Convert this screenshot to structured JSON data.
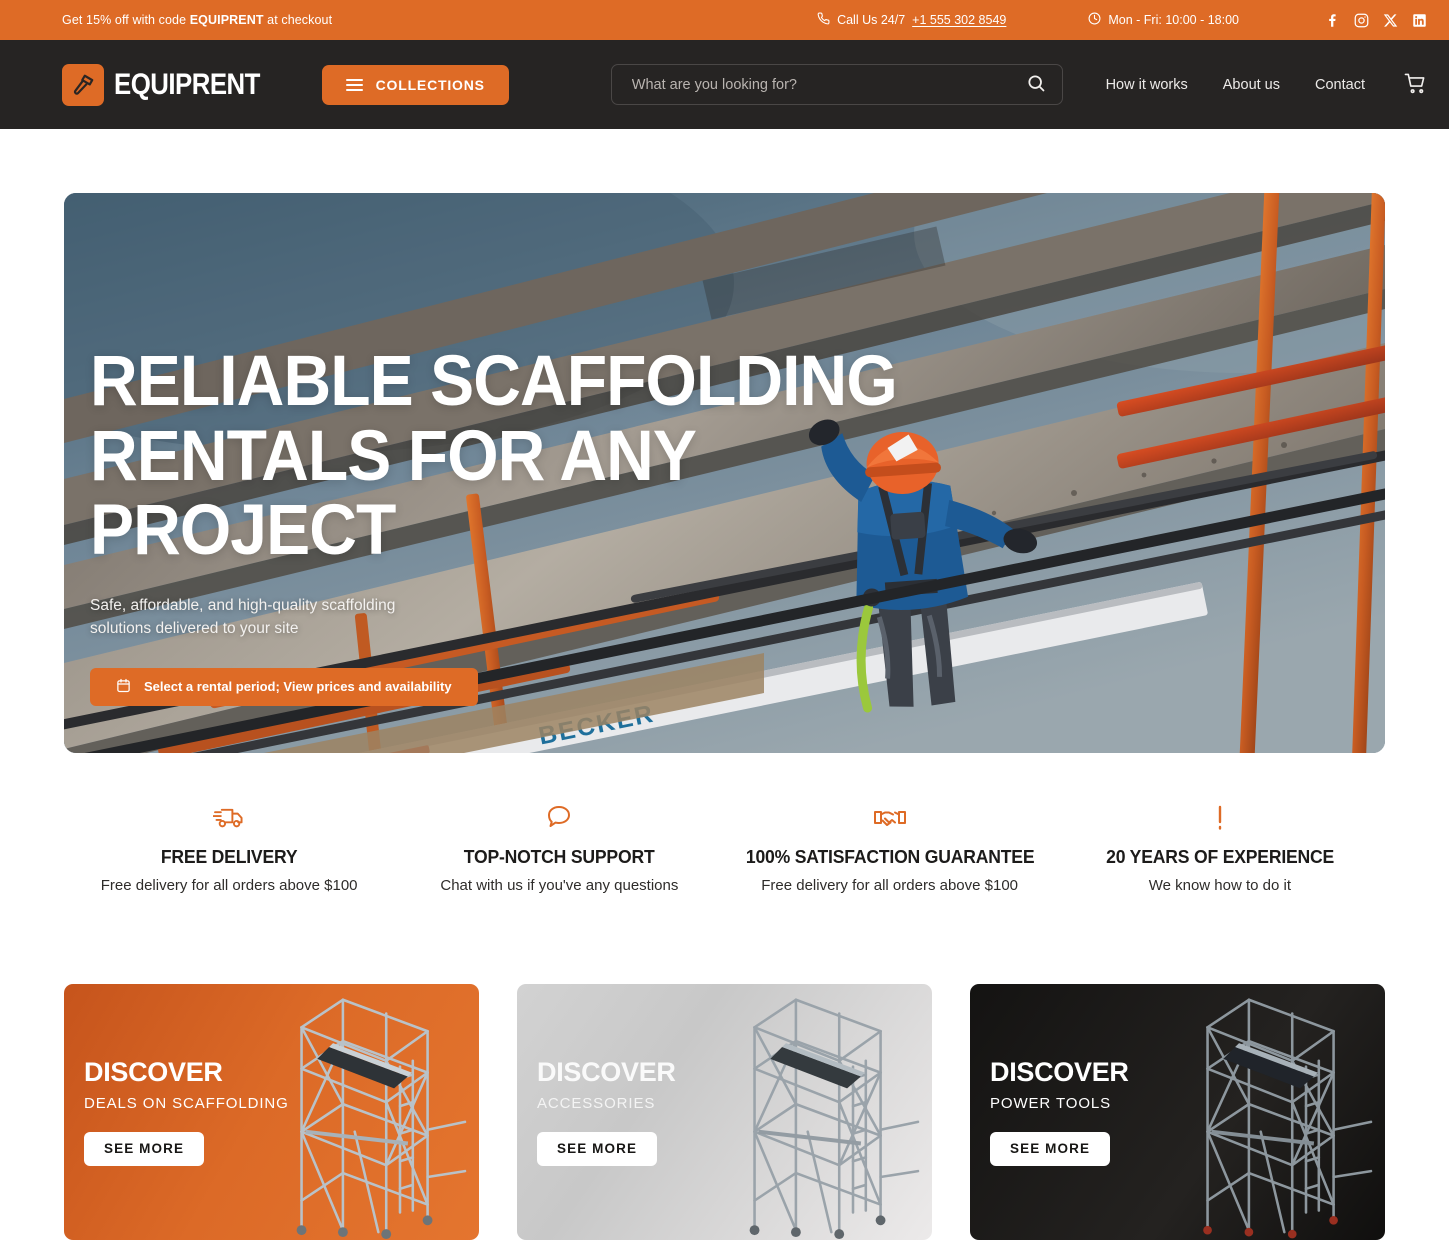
{
  "announcement": {
    "promo_prefix": "Get 15% off with code ",
    "promo_code": "EQUIPRENT",
    "promo_suffix": " at checkout",
    "phone_label": "Call Us 24/7",
    "phone_number": "+1 555 302 8549",
    "hours": "Mon - Fri: 10:00 - 18:00",
    "socials": [
      "facebook-icon",
      "instagram-icon",
      "x-twitter-icon",
      "linkedin-icon"
    ],
    "background_color": "#DE6B26"
  },
  "header": {
    "brand_name": "EQUIPRENT",
    "brand_icon": "hammer-icon",
    "collections_label": "COLLECTIONS",
    "search_placeholder": "What are you looking for?",
    "search_value": "",
    "nav": [
      {
        "label": "How it works"
      },
      {
        "label": "About us"
      },
      {
        "label": "Contact"
      }
    ],
    "cart_icon": "shopping-cart-icon",
    "background_color": "#262423"
  },
  "hero": {
    "title_line1": "RELIABLE SCAFFOLDING",
    "title_line2": "RENTALS FOR ANY PROJECT",
    "subtitle": "Safe, affordable, and high-quality scaffolding solutions delivered to your site",
    "cta_label": "Select a rental period; View prices and availability",
    "cta_icon": "calendar-icon",
    "accent_color": "#DE6B26"
  },
  "features": [
    {
      "icon": "delivery-truck-icon",
      "title": "FREE DELIVERY",
      "desc": "Free delivery for all orders above $100"
    },
    {
      "icon": "chat-bubble-icon",
      "title": "TOP-NOTCH SUPPORT",
      "desc": "Chat with us if you've any questions"
    },
    {
      "icon": "handshake-icon",
      "title": "100% SATISFACTION GUARANTEE",
      "desc": "Free delivery for all orders above $100"
    },
    {
      "icon": "exclamation-icon",
      "title": "20 YEARS OF EXPERIENCE",
      "desc": "We know how to do it"
    }
  ],
  "cards": [
    {
      "title": "DISCOVER",
      "subtitle": "DEALS ON SCAFFOLDING",
      "button": "SEE MORE",
      "theme": "orange",
      "art": "scaffolding-tower-image"
    },
    {
      "title": "DISCOVER",
      "subtitle": "ACCESSORIES",
      "button": "SEE MORE",
      "theme": "grey",
      "art": "scaffolding-tower-image"
    },
    {
      "title": "DISCOVER",
      "subtitle": "POWER TOOLS",
      "button": "SEE MORE",
      "theme": "dark",
      "art": "scaffolding-tower-image"
    }
  ]
}
